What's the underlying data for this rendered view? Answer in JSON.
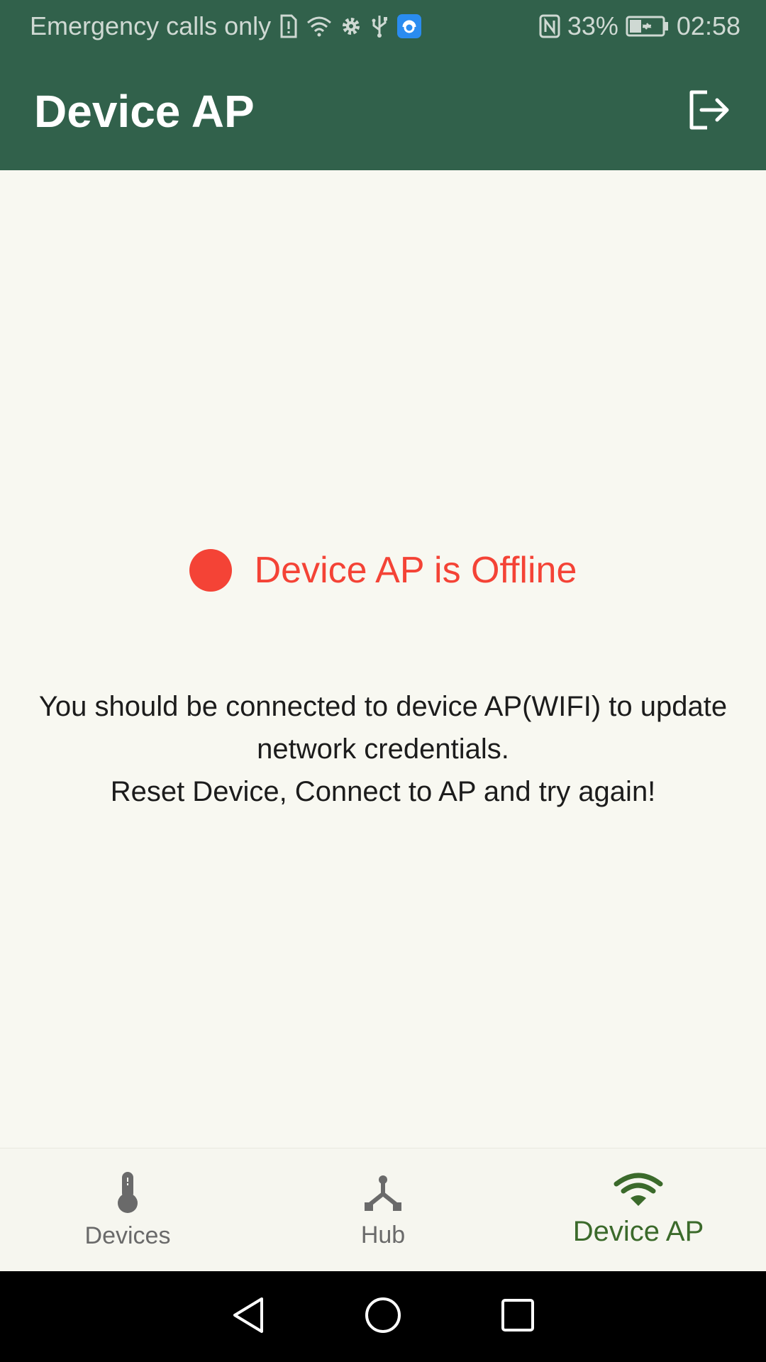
{
  "status_bar": {
    "carrier": "Emergency calls only",
    "battery": "33%",
    "time": "02:58"
  },
  "app_bar": {
    "title": "Device AP"
  },
  "status": {
    "label": "Device AP is Offline",
    "color": "#f44336"
  },
  "message": {
    "line1": "You should be connected to device AP(WIFI) to update",
    "line2": "network credentials.",
    "line3": "Reset Device, Connect to AP and try again!"
  },
  "bottom_nav": {
    "items": [
      {
        "label": "Devices",
        "icon": "thermometer-icon"
      },
      {
        "label": "Hub",
        "icon": "hub-icon"
      },
      {
        "label": "Device AP",
        "icon": "wifi-icon",
        "active": true
      }
    ]
  },
  "colors": {
    "primary": "#31614b",
    "active_nav": "#3b6a2b",
    "background": "#f8f8f1"
  }
}
